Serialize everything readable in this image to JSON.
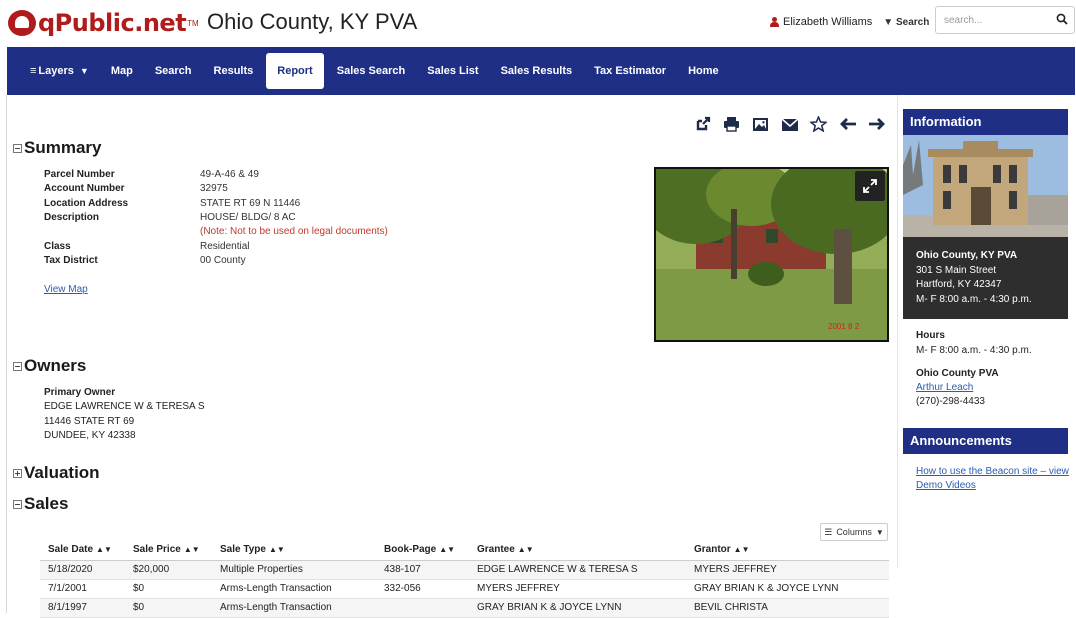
{
  "header": {
    "logo_text": "qPublic.net",
    "logo_tm": "TM",
    "site_title": "Ohio County, KY PVA",
    "user_name": "Elizabeth Williams",
    "search_label": "Search",
    "search_placeholder": "search..."
  },
  "nav": {
    "items": [
      "Layers",
      "Map",
      "Search",
      "Results",
      "Report",
      "Sales Search",
      "Sales List",
      "Sales Results",
      "Tax Estimator",
      "Home"
    ],
    "active": "Report"
  },
  "summary": {
    "heading": "Summary",
    "rows": [
      {
        "label": "Parcel Number",
        "value": "49-A-46 & 49"
      },
      {
        "label": "Account Number",
        "value": "32975"
      },
      {
        "label": "Location Address",
        "value": "STATE RT 69 N 11446"
      },
      {
        "label": "Description",
        "value": "HOUSE/ BLDG/ 8 AC"
      },
      {
        "label": "",
        "value": "(Note: Not to be used on legal documents)"
      },
      {
        "label": "Class",
        "value": "Residential"
      },
      {
        "label": "Tax District",
        "value": "00 County"
      }
    ],
    "view_map": "View Map"
  },
  "photo": {
    "date_stamp": "2001 8 2"
  },
  "owners": {
    "heading": "Owners",
    "primary_label": "Primary Owner",
    "lines": [
      "EDGE LAWRENCE W & TERESA S",
      "11446 STATE RT 69",
      "DUNDEE, KY 42338"
    ]
  },
  "valuation": {
    "heading": "Valuation"
  },
  "sales": {
    "heading": "Sales",
    "columns_label": "Columns",
    "headers": [
      "Sale Date",
      "Sale Price",
      "Sale Type",
      "Book-Page",
      "Grantee",
      "Grantor"
    ],
    "rows": [
      [
        "5/18/2020",
        "$20,000",
        "Multiple Properties",
        "438-107",
        "EDGE LAWRENCE W & TERESA S",
        "MYERS JEFFREY"
      ],
      [
        "7/1/2001",
        "$0",
        "Arms-Length Transaction",
        "332-056",
        "MYERS JEFFREY",
        "GRAY BRIAN K & JOYCE LYNN"
      ],
      [
        "8/1/1997",
        "$0",
        "Arms-Length Transaction",
        "",
        "GRAY BRIAN K & JOYCE LYNN",
        "BEVIL CHRISTA"
      ]
    ]
  },
  "sidebar": {
    "info_heading": "Information",
    "address_lines": [
      "Ohio County, KY PVA",
      "301 S Main Street",
      "Hartford, KY 42347",
      "M- F 8:00 a.m. - 4:30 p.m."
    ],
    "hours_label": "Hours",
    "hours_value": "M- F 8:00 a.m. - 4:30 p.m.",
    "pva_label": "Ohio County PVA",
    "pva_name": "Arthur Leach",
    "pva_phone": "(270)-298-4433",
    "announcements_heading": "Announcements",
    "announcement_link": "How to use the Beacon site – view Demo Videos"
  },
  "colors": {
    "nav_bg": "#1e2f85",
    "brand_red": "#b01c1c",
    "note_red": "#c0392b",
    "link_blue": "#2a5db0"
  }
}
